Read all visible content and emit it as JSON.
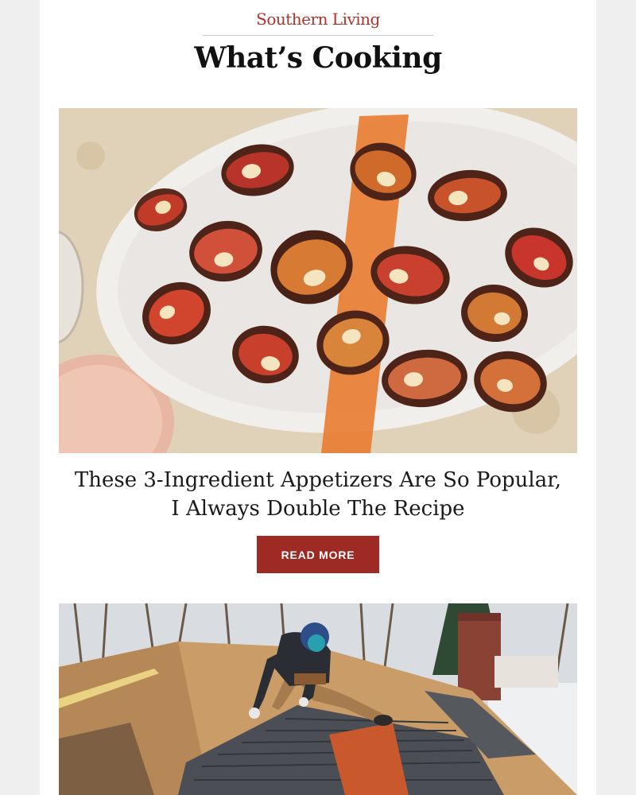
{
  "header": {
    "brand": "Southern Living",
    "section_title": "What’s Cooking"
  },
  "articles": [
    {
      "title": "These 3-Ingredient Appetizers Are So Popular, I Always Double The Recipe",
      "cta": "READ MORE",
      "image_subject": "bacon-wrapped dates on white platter"
    },
    {
      "image_subject": "worker installing shingles on a roof"
    }
  ],
  "colors": {
    "brand": "#b0342c",
    "button": "#9e2a24",
    "page_bg": "#efefef",
    "card_bg": "#ffffff"
  }
}
